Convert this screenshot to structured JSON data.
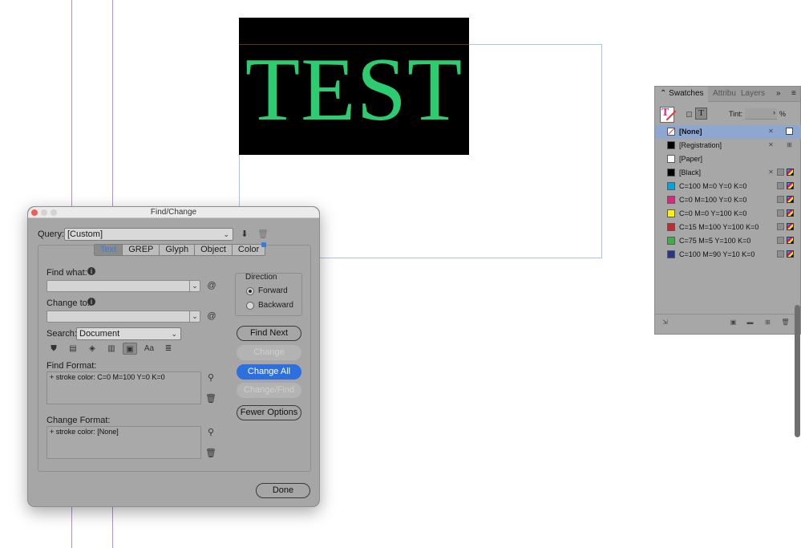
{
  "canvas": {
    "test_text": "TEST"
  },
  "dialog": {
    "title": "Find/Change",
    "query_label": "Query:",
    "query_value": "[Custom]",
    "tabs": [
      {
        "label": "Text"
      },
      {
        "label": "GREP"
      },
      {
        "label": "Glyph"
      },
      {
        "label": "Object"
      },
      {
        "label": "Color"
      }
    ],
    "find_what_label": "Find what:",
    "find_what_value": "",
    "change_to_label": "Change to:",
    "change_to_value": "",
    "search_label": "Search:",
    "search_value": "Document",
    "direction_label": "Direction",
    "forward_label": "Forward",
    "backward_label": "Backward",
    "direction_selected": "Forward",
    "find_format_label": "Find Format:",
    "find_format_value": "+ stroke color: C=0 M=100 Y=0 K=0",
    "change_format_label": "Change Format:",
    "change_format_value": "+ stroke color: [None]",
    "buttons": {
      "find_next": "Find Next",
      "change": "Change",
      "change_all": "Change All",
      "change_find": "Change/Find",
      "fewer_options": "Fewer Options",
      "done": "Done"
    },
    "tool_icons": [
      "locked-layers-icon",
      "locked-stories-icon",
      "hidden-layers-icon",
      "master-pages-icon",
      "footnotes-icon",
      "case-sensitive-icon",
      "whole-word-icon"
    ],
    "special_char_icon": "@"
  },
  "swatches_panel": {
    "tabs": [
      "Swatches",
      "Attribu",
      "Layers"
    ],
    "active_tab": "Swatches",
    "tint_label": "Tint:",
    "tint_value": "",
    "tint_unit": "%",
    "swatches": [
      {
        "name": "[None]",
        "color": "none",
        "selected": true
      },
      {
        "name": "[Registration]",
        "color": "#000000"
      },
      {
        "name": "[Paper]",
        "color": "#ffffff"
      },
      {
        "name": "[Black]",
        "color": "#000000"
      },
      {
        "name": "C=100 M=0 Y=0 K=0",
        "color": "#00a6e0"
      },
      {
        "name": "C=0 M=100 Y=0 K=0",
        "color": "#e0247f"
      },
      {
        "name": "C=0 M=0 Y=100 K=0",
        "color": "#fff200"
      },
      {
        "name": "C=15 M=100 Y=100 K=0",
        "color": "#c8282c"
      },
      {
        "name": "C=75 M=5 Y=100 K=0",
        "color": "#3fae49"
      },
      {
        "name": "C=100 M=90 Y=10 K=0",
        "color": "#26378c"
      }
    ]
  },
  "colors": {
    "text_fill": "#2ecc71",
    "frame_fill": "#000000",
    "accent": "#2d6fdc",
    "selection": "#8ea7d0"
  }
}
